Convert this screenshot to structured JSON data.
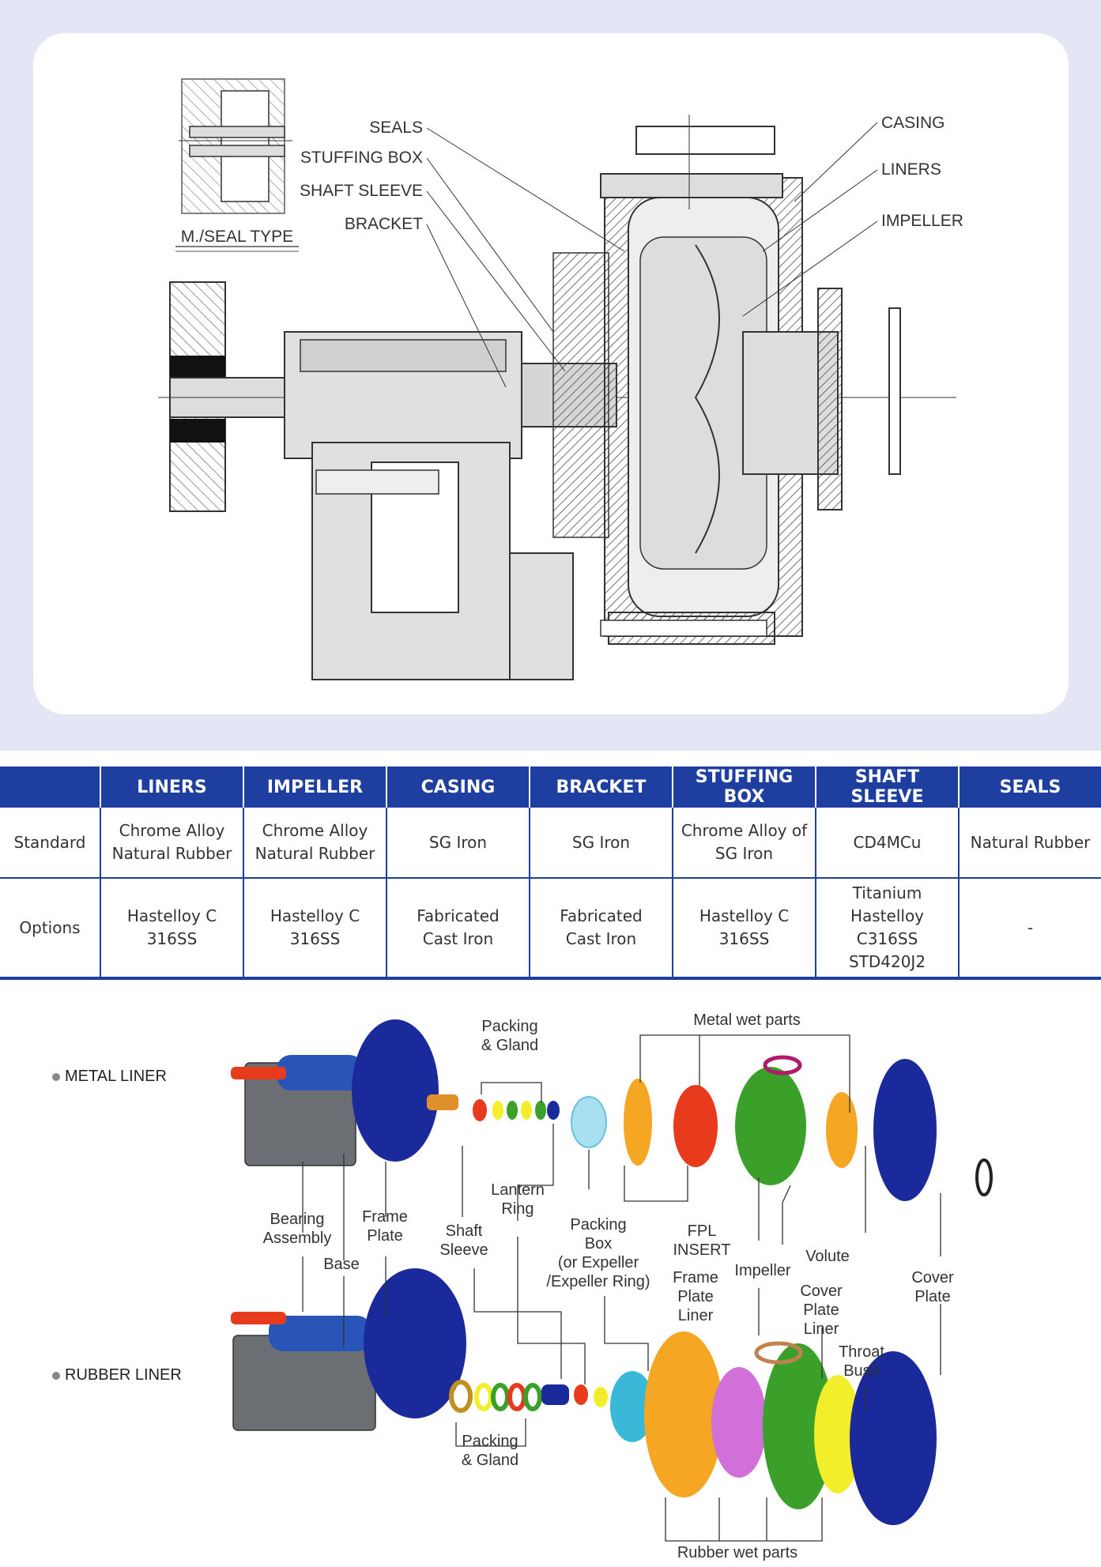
{
  "cross_section": {
    "inset_label": "M./SEAL TYPE",
    "left_labels": [
      "SEALS",
      "STUFFING BOX",
      "SHAFT SLEEVE",
      "BRACKET"
    ],
    "right_labels": [
      "CASING",
      "LINERS",
      "IMPELLER"
    ]
  },
  "table": {
    "headers": [
      "LINERS",
      "IMPELLER",
      "CASING",
      "BRACKET",
      "STUFFING BOX",
      "SHAFT SLEEVE",
      "SEALS"
    ],
    "rows": [
      {
        "label": "Standard",
        "cells": [
          "Chrome Alloy\nNatural Rubber",
          "Chrome Alloy\nNatural Rubber",
          "SG Iron",
          "SG Iron",
          "Chrome Alloy of\nSG Iron",
          "CD4MCu",
          "Natural Rubber"
        ]
      },
      {
        "label": "Options",
        "cells": [
          "Hastelloy C\n316SS",
          "Hastelloy C\n316SS",
          "Fabricated\nCast Iron",
          "Fabricated\nCast Iron",
          "Hastelloy C\n316SS",
          "Titanium\nHastelloy C316SS\nSTD420J2",
          "-"
        ]
      }
    ]
  },
  "exploded": {
    "metal_liner": "METAL LINER",
    "rubber_liner": "RUBBER LINER",
    "labels": {
      "packing_gland_top": "Packing\n& Gland",
      "metal_wet_parts": "Metal wet parts",
      "lantern_ring": "Lantern\nRing",
      "bearing_assembly": "Bearing\nAssembly",
      "frame_plate": "Frame\nPlate",
      "base": "Base",
      "shaft_sleeve": "Shaft\nSleeve",
      "packing_box": "Packing\nBox\n(or Expeller\n/Expeller Ring)",
      "fpl_insert": "FPL\nINSERT",
      "frame_plate_liner": "Frame\nPlate\nLiner",
      "impeller": "Impeller",
      "volute": "Volute",
      "cover_plate_liner": "Cover\nPlate\nLiner",
      "throat_bush": "Throat\nBush",
      "cover_plate": "Cover\nPlate",
      "packing_gland_bottom": "Packing\n& Gland",
      "rubber_wet_parts": "Rubber wet parts"
    }
  },
  "colors": {
    "band": "#e4e5f5",
    "table_header": "#1f3fa0",
    "pump_blue": "#1a2a9a",
    "base_gray": "#6b6e73",
    "orange": "#f5a623",
    "red": "#e83a1c",
    "green": "#3aa02a",
    "yellow": "#f2ee2a",
    "magenta": "#d070d8",
    "cyan": "#3ab8d8"
  }
}
